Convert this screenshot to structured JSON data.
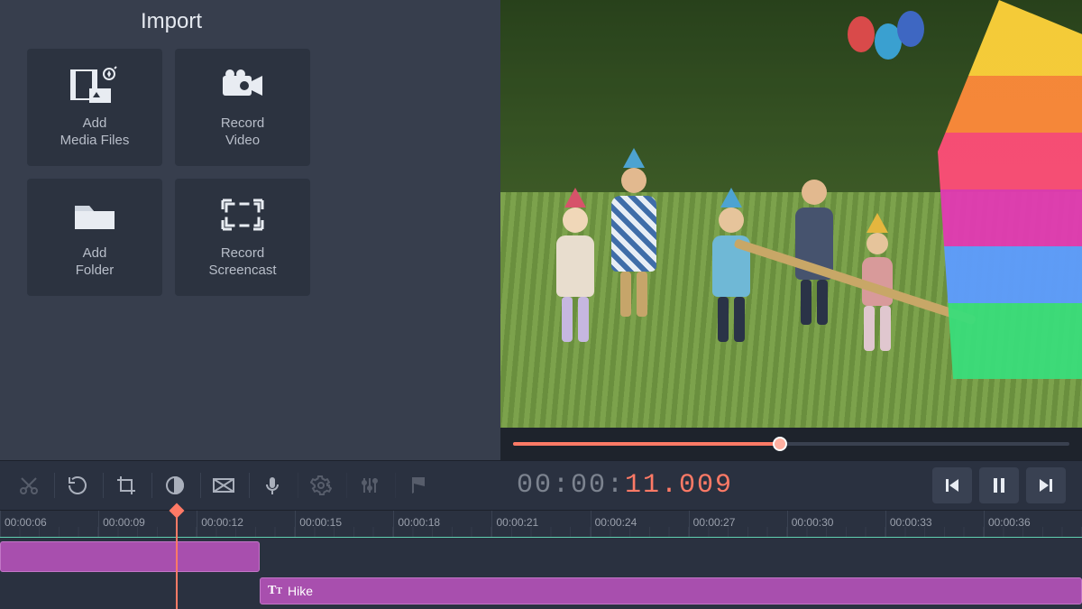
{
  "import": {
    "title": "Import",
    "tiles": [
      {
        "label": "Add\nMedia Files",
        "icon": "media-files"
      },
      {
        "label": "Record\nVideo",
        "icon": "record-video"
      },
      {
        "label": "Add\nFolder",
        "icon": "add-folder"
      },
      {
        "label": "Record\nScreencast",
        "icon": "record-screencast"
      }
    ]
  },
  "preview": {
    "scrubber_progress_percent": 48
  },
  "timecode": {
    "gray": "00:00:",
    "accent": "11.009"
  },
  "toolbar_icons": [
    "cut",
    "redo",
    "crop",
    "color-adjust",
    "transition",
    "microphone",
    "settings",
    "equalizer",
    "flag"
  ],
  "timeline": {
    "ticks": [
      "00:00:06",
      "00:00:09",
      "00:00:12",
      "00:00:15",
      "00:00:18",
      "00:00:21",
      "00:00:24",
      "00:00:27",
      "00:00:30",
      "00:00:33",
      "00:00:36"
    ],
    "title_clip_label": "Hike"
  }
}
